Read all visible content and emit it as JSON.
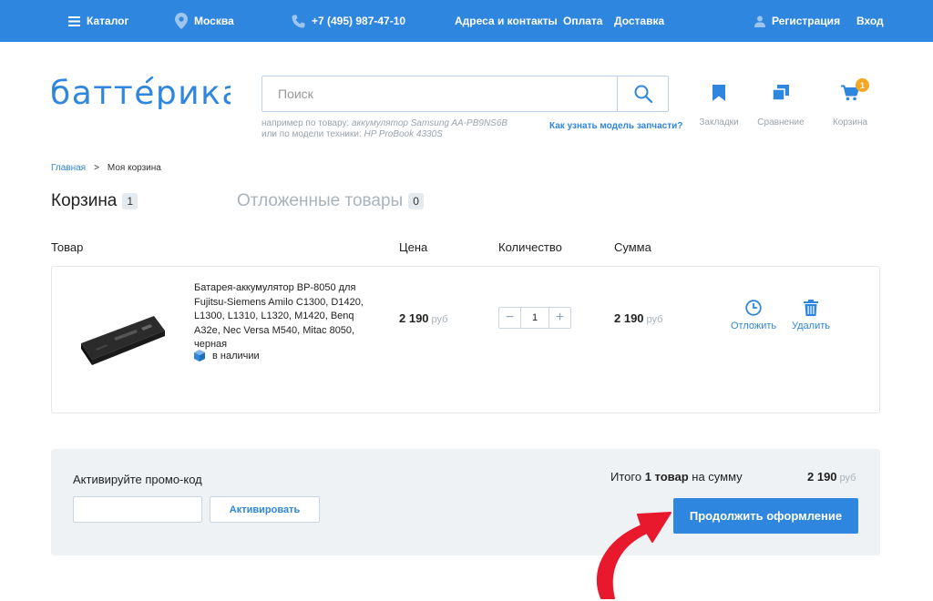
{
  "topbar": {
    "catalog": "Каталог",
    "city": "Москва",
    "phone": "+7 (495) 987-47-10",
    "nav": [
      "Адреса и контакты",
      "Оплата",
      "Доставка"
    ],
    "register": "Регистрация",
    "login": "Вход"
  },
  "header": {
    "logo_text": "баттерика",
    "search_placeholder": "Поиск",
    "hint_line1_prefix": "например по товару: ",
    "hint_line1_example": "аккумулятор Samsung AA-PB9NS6B",
    "hint_line2_prefix": "или по модели техники: ",
    "hint_line2_example": "HP ProBook 4330S",
    "model_link": "Как узнать модель запчасти?",
    "icons": {
      "bookmarks": "Закладки",
      "compare": "Сравнение",
      "cart": "Корзина",
      "cart_count": "1"
    }
  },
  "breadcrumb": {
    "home": "Главная",
    "sep": ">",
    "current": "Моя корзина"
  },
  "tabs": {
    "cart_label": "Корзина",
    "cart_count": "1",
    "deferred_label": "Отложенные товары",
    "deferred_count": "0"
  },
  "table": {
    "headers": [
      "Товар",
      "Цена",
      "Количество",
      "Сумма"
    ]
  },
  "product": {
    "name": "Батарея-аккумулятор BP-8050 для Fujitsu-Siemens Amilo C1300, D1420, L1300, L1310, L1320, M1420, Benq A32e, Nec Versa M540, Mitac 8050, черная",
    "stock": "в наличии",
    "price": "2 190",
    "currency": "руб",
    "quantity": "1",
    "sum": "2 190",
    "defer_label": "Отложить",
    "delete_label": "Удалить"
  },
  "summary": {
    "promo_title": "Активируйте промо-код",
    "promo_button": "Активировать",
    "total_prefix": "Итого ",
    "total_count": "1 товар",
    "total_suffix": " на сумму",
    "total_amount": "2 190",
    "currency": "руб",
    "checkout_button": "Продолжить оформление"
  },
  "colors": {
    "brand_blue": "#2f86de",
    "badge_orange": "#f5a623",
    "arrow_red": "#e8192c"
  }
}
